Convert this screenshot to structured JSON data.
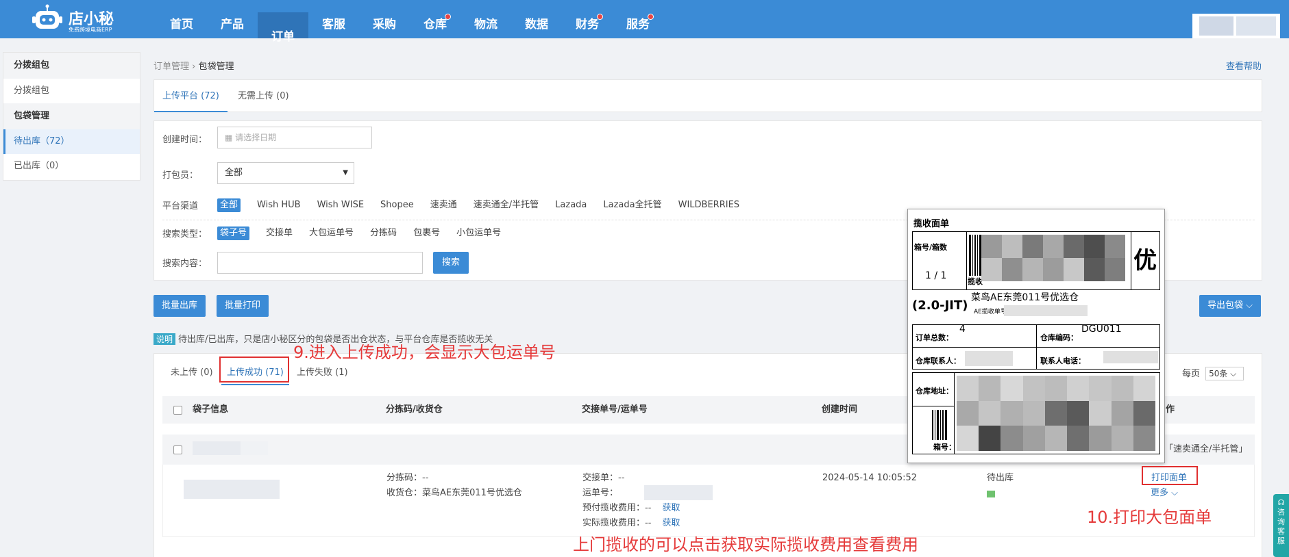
{
  "logo": {
    "brand": "店小秘",
    "tagline": "免费跨境电商ERP"
  },
  "nav": [
    {
      "label": "首页",
      "active": false,
      "dot": false
    },
    {
      "label": "产品",
      "active": false,
      "dot": false
    },
    {
      "label": "订单",
      "active": true,
      "dot": false
    },
    {
      "label": "客服",
      "active": false,
      "dot": false
    },
    {
      "label": "采购",
      "active": false,
      "dot": false
    },
    {
      "label": "仓库",
      "active": false,
      "dot": true
    },
    {
      "label": "物流",
      "active": false,
      "dot": false
    },
    {
      "label": "数据",
      "active": false,
      "dot": false
    },
    {
      "label": "财务",
      "active": false,
      "dot": true
    },
    {
      "label": "服务",
      "active": false,
      "dot": true
    }
  ],
  "sidebar": {
    "group1": "分拨组包",
    "item1": "分拨组包",
    "group2": "包袋管理",
    "item2": "待出库（72）",
    "item3": "已出库（0）"
  },
  "breadcrumb": {
    "parent": "订单管理",
    "sep": "›",
    "current": "包袋管理"
  },
  "help": "查看帮助",
  "upload_tabs": {
    "tab1": "上传平台 (72)",
    "tab2": "无需上传 (0)"
  },
  "filters": {
    "created_label": "创建时间：",
    "date_placeholder": "请选择日期",
    "packer_label": "打包员：",
    "packer_value": "全部",
    "channel_label": "平台渠道",
    "channels": [
      "全部",
      "Wish HUB",
      "Wish WISE",
      "Shopee",
      "速卖通",
      "速卖通全/半托管",
      "Lazada",
      "Lazada全托管",
      "WILDBERRIES"
    ],
    "search_type_label": "搜索类型：",
    "search_types": [
      "袋子号",
      "交接单",
      "大包运单号",
      "分拣码",
      "包裹号",
      "小包运单号"
    ],
    "content_label": "搜索内容：",
    "search_button": "搜索"
  },
  "actions": {
    "batch_out": "批量出库",
    "batch_print": "批量打印",
    "export": "导出包袋 ⌵"
  },
  "note": {
    "tag": "说明",
    "text": "待出库/已出库，只是店小秘区分的包袋是否出仓状态，与平台仓库是否揽收无关"
  },
  "sub_tabs": {
    "tab1": "未上传 (0)",
    "tab2": "上传成功 (71)",
    "tab3": "上传失败 (1)"
  },
  "pager": {
    "prefix": "每页",
    "value": "50条 ⌵"
  },
  "table": {
    "col_bag": "袋子信息",
    "col_sort": "分拣码/收货仓",
    "col_handover": "交接单号/运单号",
    "col_created": "创建时间",
    "col_op": "作",
    "row": {
      "channel_tag": "「速卖通全/半托管」",
      "sort_code": "分拣码：--",
      "warehouse": "收货仓：菜鸟AE东莞011号优选仓",
      "handover": "交接单：--",
      "waybill": "运单号：",
      "prepaid_fee": "预付揽收费用：--",
      "actual_fee": "实际揽收费用：--",
      "get": "获取",
      "created": "2024-05-14 10:05:52",
      "status": "待出库",
      "print": "打印面单",
      "more": "更多 ⌵"
    }
  },
  "label": {
    "title": "揽收面单",
    "box_no_label": "箱号/箱数",
    "box_no": "1 / 1",
    "collect": "揽收",
    "priority": "优",
    "jit": "(2.0-JIT)",
    "warehouse": "菜鸟AE东莞011号优选仓",
    "ae_no_label": "AE揽收单号：",
    "ae_no_prefix": "P",
    "total_label": "订单总数：",
    "total": "4",
    "code_label": "仓库编码：",
    "code": "DGU011",
    "contact_label": "仓库联系人：",
    "phone_label": "联系人电话：",
    "addr_label": "仓库地址：",
    "box_label": "箱号："
  },
  "annotations": {
    "a9": "9.进入上传成功，会显示大包运单号",
    "a10": "10.打印大包面单",
    "fee": "上门揽收的可以点击获取实际揽收费用查看费用"
  },
  "float_service": "咨询客服",
  "colors": {
    "nav": "#3b8bd6",
    "accent": "#2f74b8",
    "annotation": "#e53a3a"
  }
}
